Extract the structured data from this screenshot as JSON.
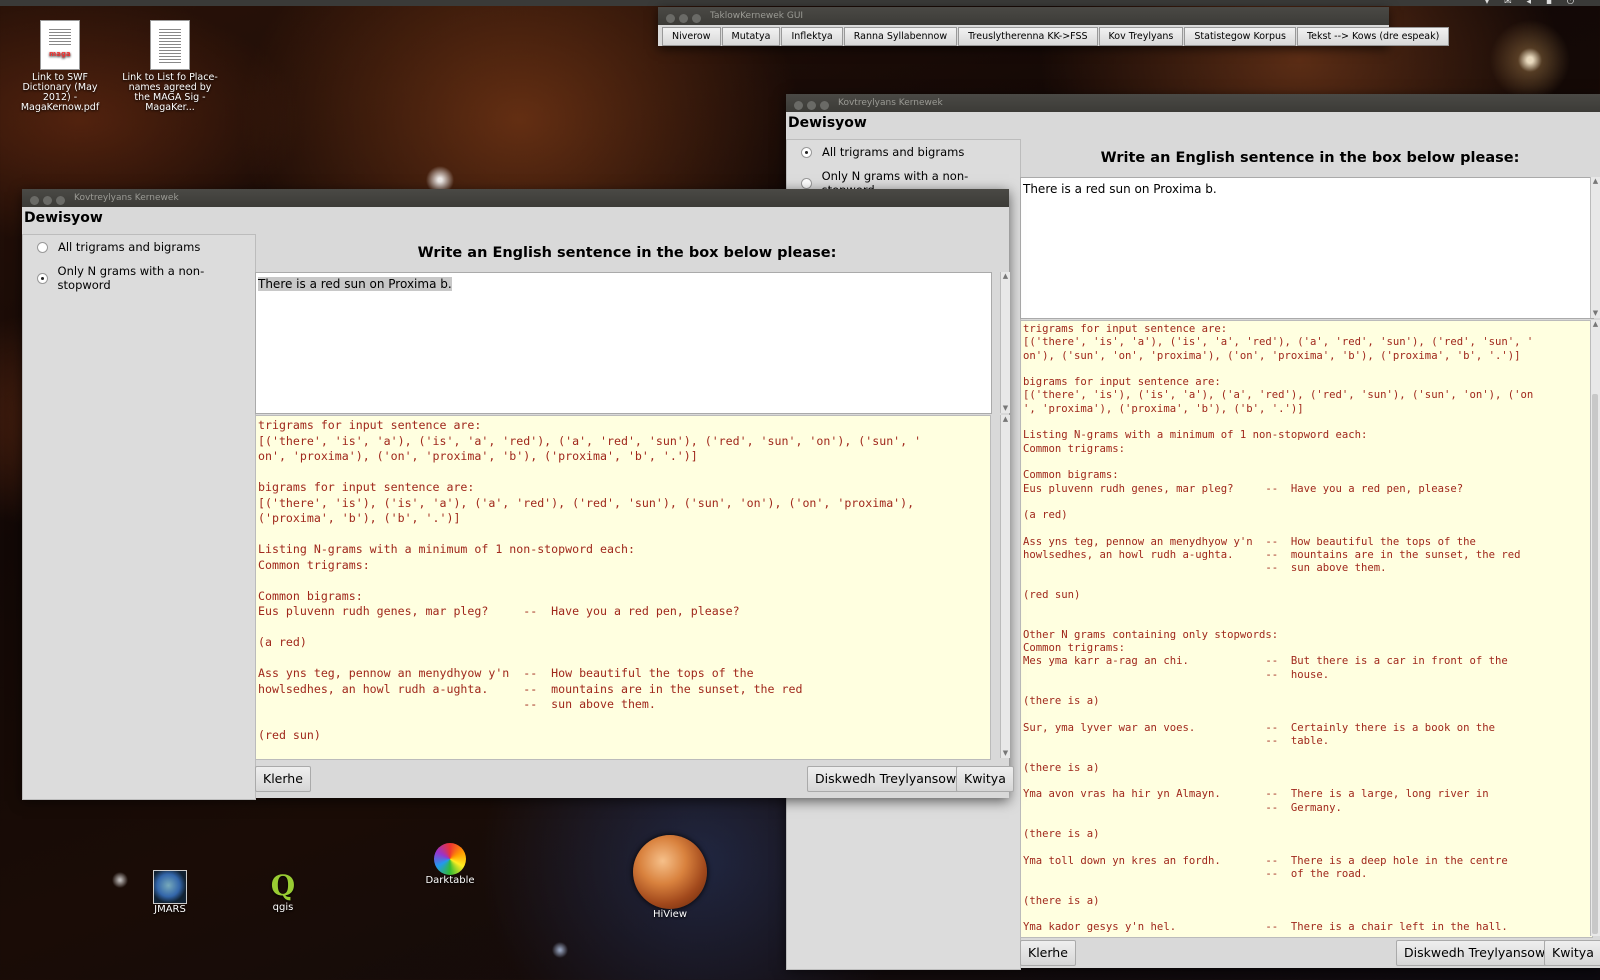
{
  "desktop": {
    "icons": [
      {
        "label": "Link to SWF Dictionary (May 2012) - MagaKernow.pdf",
        "name": "maga-pdf"
      },
      {
        "label": "Link to List fo Place-names agreed by the MAGA Sig - MagaKer...",
        "name": "placenames"
      },
      {
        "label": "JMARS",
        "name": "jmars"
      },
      {
        "label": "qgis",
        "name": "qgis"
      },
      {
        "label": "Darktable",
        "name": "darktable"
      },
      {
        "label": "HiView",
        "name": "hiview"
      }
    ],
    "doc_brand": "maga"
  },
  "toolbar_window": {
    "title": "TaklowKernewek GUI",
    "buttons": [
      "Niverow",
      "Mutatya",
      "Inflektya",
      "Ranna Syllabennow",
      "Treuslytherenna KK->FSS",
      "Kov Treylyans",
      "Statistegow Korpus",
      "Tekst --> Kows (dre espeak)"
    ]
  },
  "back_window": {
    "title": "Kovtreylyans Kernewek",
    "header": "Dewisyow",
    "options": [
      "All trigrams and bigrams",
      "Only N grams with a non-stopword"
    ],
    "selected_option": 0,
    "prompt": "Write an English sentence in the box below please:",
    "input_text": "There is a red sun on Proxima b.",
    "output_text": "trigrams for input sentence are:\n[('there', 'is', 'a'), ('is', 'a', 'red'), ('a', 'red', 'sun'), ('red', 'sun', '\non'), ('sun', 'on', 'proxima'), ('on', 'proxima', 'b'), ('proxima', 'b', '.')]\n\nbigrams for input sentence are:\n[('there', 'is'), ('is', 'a'), ('a', 'red'), ('red', 'sun'), ('sun', 'on'), ('on\n', 'proxima'), ('proxima', 'b'), ('b', '.')]\n\nListing N-grams with a minimum of 1 non-stopword each:\nCommon trigrams:\n\nCommon bigrams:\nEus pluvenn rudh genes, mar pleg?     --  Have you a red pen, please?\n\n(a red)\n\nAss yns teg, pennow an menydhyow y'n  --  How beautiful the tops of the\nhowlsedhes, an howl rudh a-ughta.     --  mountains are in the sunset, the red\n                                      --  sun above them.\n\n(red sun)\n\n\nOther N grams containing only stopwords:\nCommon trigrams:\nMes yma karr a-rag an chi.            --  But there is a car in front of the\n                                      --  house.\n\n(there is a)\n\nSur, yma lyver war an voes.           --  Certainly there is a book on the\n                                      --  table.\n\n(there is a)\n\nYma avon vras ha hir yn Almayn.       --  There is a large, long river in\n                                      --  Germany.\n\n(there is a)\n\nYma toll down yn kres an fordh.       --  There is a deep hole in the centre\n                                      --  of the road.\n\n(there is a)\n\nYma kador gesys y'n hel.              --  There is a chair left in the hall.",
    "clear_label": "Klerhe",
    "save_label": "Diskwedh Treylyansow",
    "quit_label": "Kwitya"
  },
  "front_window": {
    "title": "Kovtreylyans Kernewek",
    "header": "Dewisyow",
    "options": [
      "All trigrams and bigrams",
      "Only N grams with a non-stopword"
    ],
    "selected_option": 1,
    "prompt": "Write an English sentence in the box below please:",
    "input_text": "There is a red sun on Proxima b.",
    "output_text": "trigrams for input sentence are:\n[('there', 'is', 'a'), ('is', 'a', 'red'), ('a', 'red', 'sun'), ('red', 'sun', 'on'), ('sun', '\non', 'proxima'), ('on', 'proxima', 'b'), ('proxima', 'b', '.')]\n\nbigrams for input sentence are:\n[('there', 'is'), ('is', 'a'), ('a', 'red'), ('red', 'sun'), ('sun', 'on'), ('on', 'proxima'),\n('proxima', 'b'), ('b', '.')]\n\nListing N-grams with a minimum of 1 non-stopword each:\nCommon trigrams:\n\nCommon bigrams:\nEus pluvenn rudh genes, mar pleg?     --  Have you a red pen, please?\n\n(a red)\n\nAss yns teg, pennow an menydhyow y'n  --  How beautiful the tops of the\nhowlsedhes, an howl rudh a-ughta.     --  mountains are in the sunset, the red\n                                      --  sun above them.\n\n(red sun)",
    "clear_label": "Klerhe",
    "save_label": "Diskwedh Treylyansow",
    "quit_label": "Kwitya"
  }
}
